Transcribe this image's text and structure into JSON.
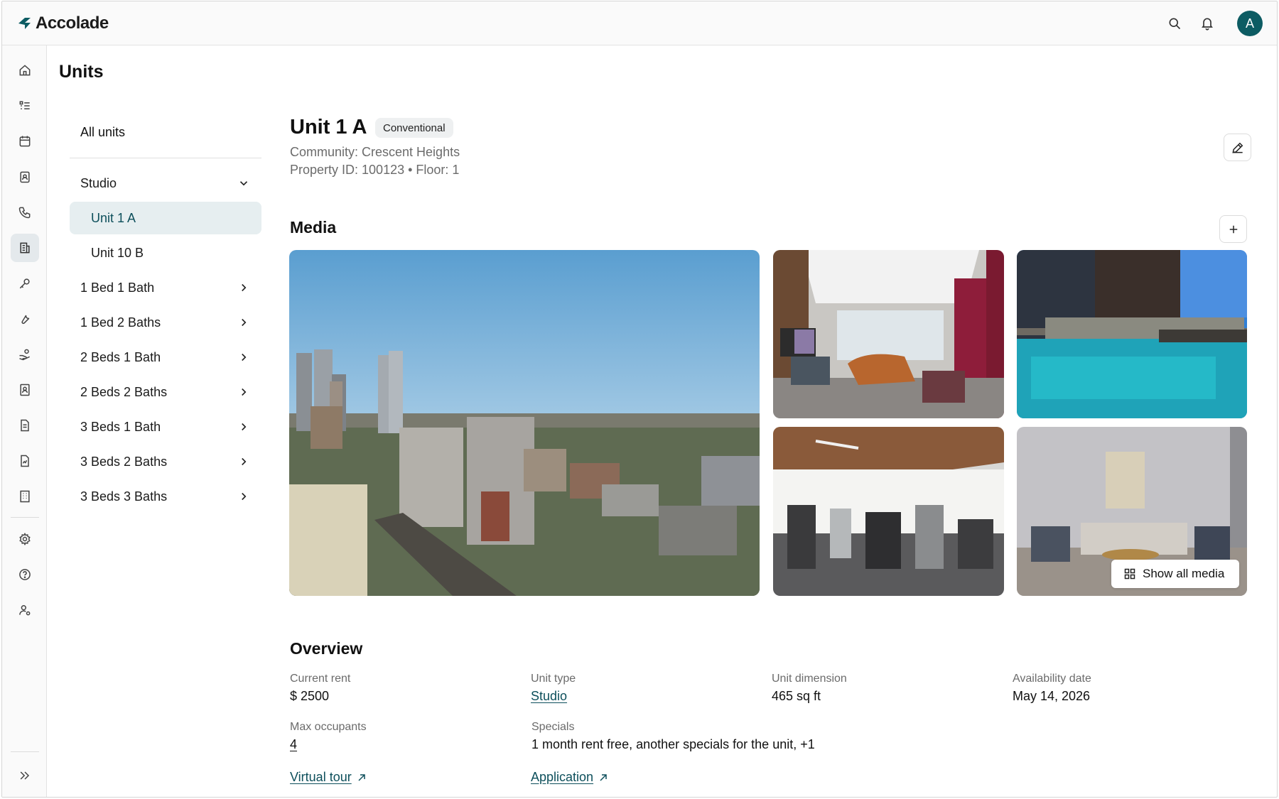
{
  "app": {
    "name": "Accolade",
    "avatar_initial": "A",
    "brand_color": "#0d5c63"
  },
  "topbar": {
    "icons": [
      "search-icon",
      "bell-icon"
    ]
  },
  "rail": {
    "items": [
      "home-icon",
      "task-list-icon",
      "calendar-icon",
      "contact-card-icon",
      "phone-icon",
      "building-icon",
      "key-icon",
      "wrench-icon",
      "hand-coin-icon",
      "id-badge-icon",
      "document-icon",
      "report-icon",
      "office-building-icon",
      "settings-icon",
      "help-icon",
      "user-settings-icon",
      "expand-icon"
    ],
    "active": "building-icon"
  },
  "page": {
    "title": "Units"
  },
  "nav": {
    "all_units": "All units",
    "groups": [
      {
        "label": "Studio",
        "expanded": true
      },
      {
        "label": "1 Bed 1 Bath"
      },
      {
        "label": "1 Bed 2 Baths"
      },
      {
        "label": "2 Beds 1 Bath"
      },
      {
        "label": "2 Beds 2 Baths"
      },
      {
        "label": "3 Beds 1 Bath"
      },
      {
        "label": "3 Beds 2 Baths"
      },
      {
        "label": "3 Beds 3 Baths"
      }
    ],
    "studio_units": [
      "Unit 1 A",
      "Unit 10 B"
    ],
    "selected": "Unit 1 A"
  },
  "unit": {
    "name": "Unit 1 A",
    "badge": "Conventional",
    "community": "Community: Crescent Heights",
    "property": "Property ID: 100123 • Floor: 1"
  },
  "media": {
    "title": "Media",
    "show_all": "Show all media",
    "photos": [
      "city-skyline-photo",
      "lounge-photo",
      "pool-photo",
      "gym-photo",
      "living-room-photo"
    ]
  },
  "overview": {
    "title": "Overview",
    "current_rent_label": "Current rent",
    "current_rent": "$ 2500",
    "unit_type_label": "Unit type",
    "unit_type": "Studio",
    "unit_dimension_label": "Unit dimension",
    "unit_dimension": "465 sq ft",
    "availability_label": "Availability date",
    "availability": "May 14, 2026",
    "max_occupants_label": "Max occupants",
    "max_occupants": "4",
    "specials_label": "Specials",
    "specials": "1 month rent free, another specials for the unit, +1",
    "virtual_tour": "Virtual tour",
    "application": "Application"
  }
}
